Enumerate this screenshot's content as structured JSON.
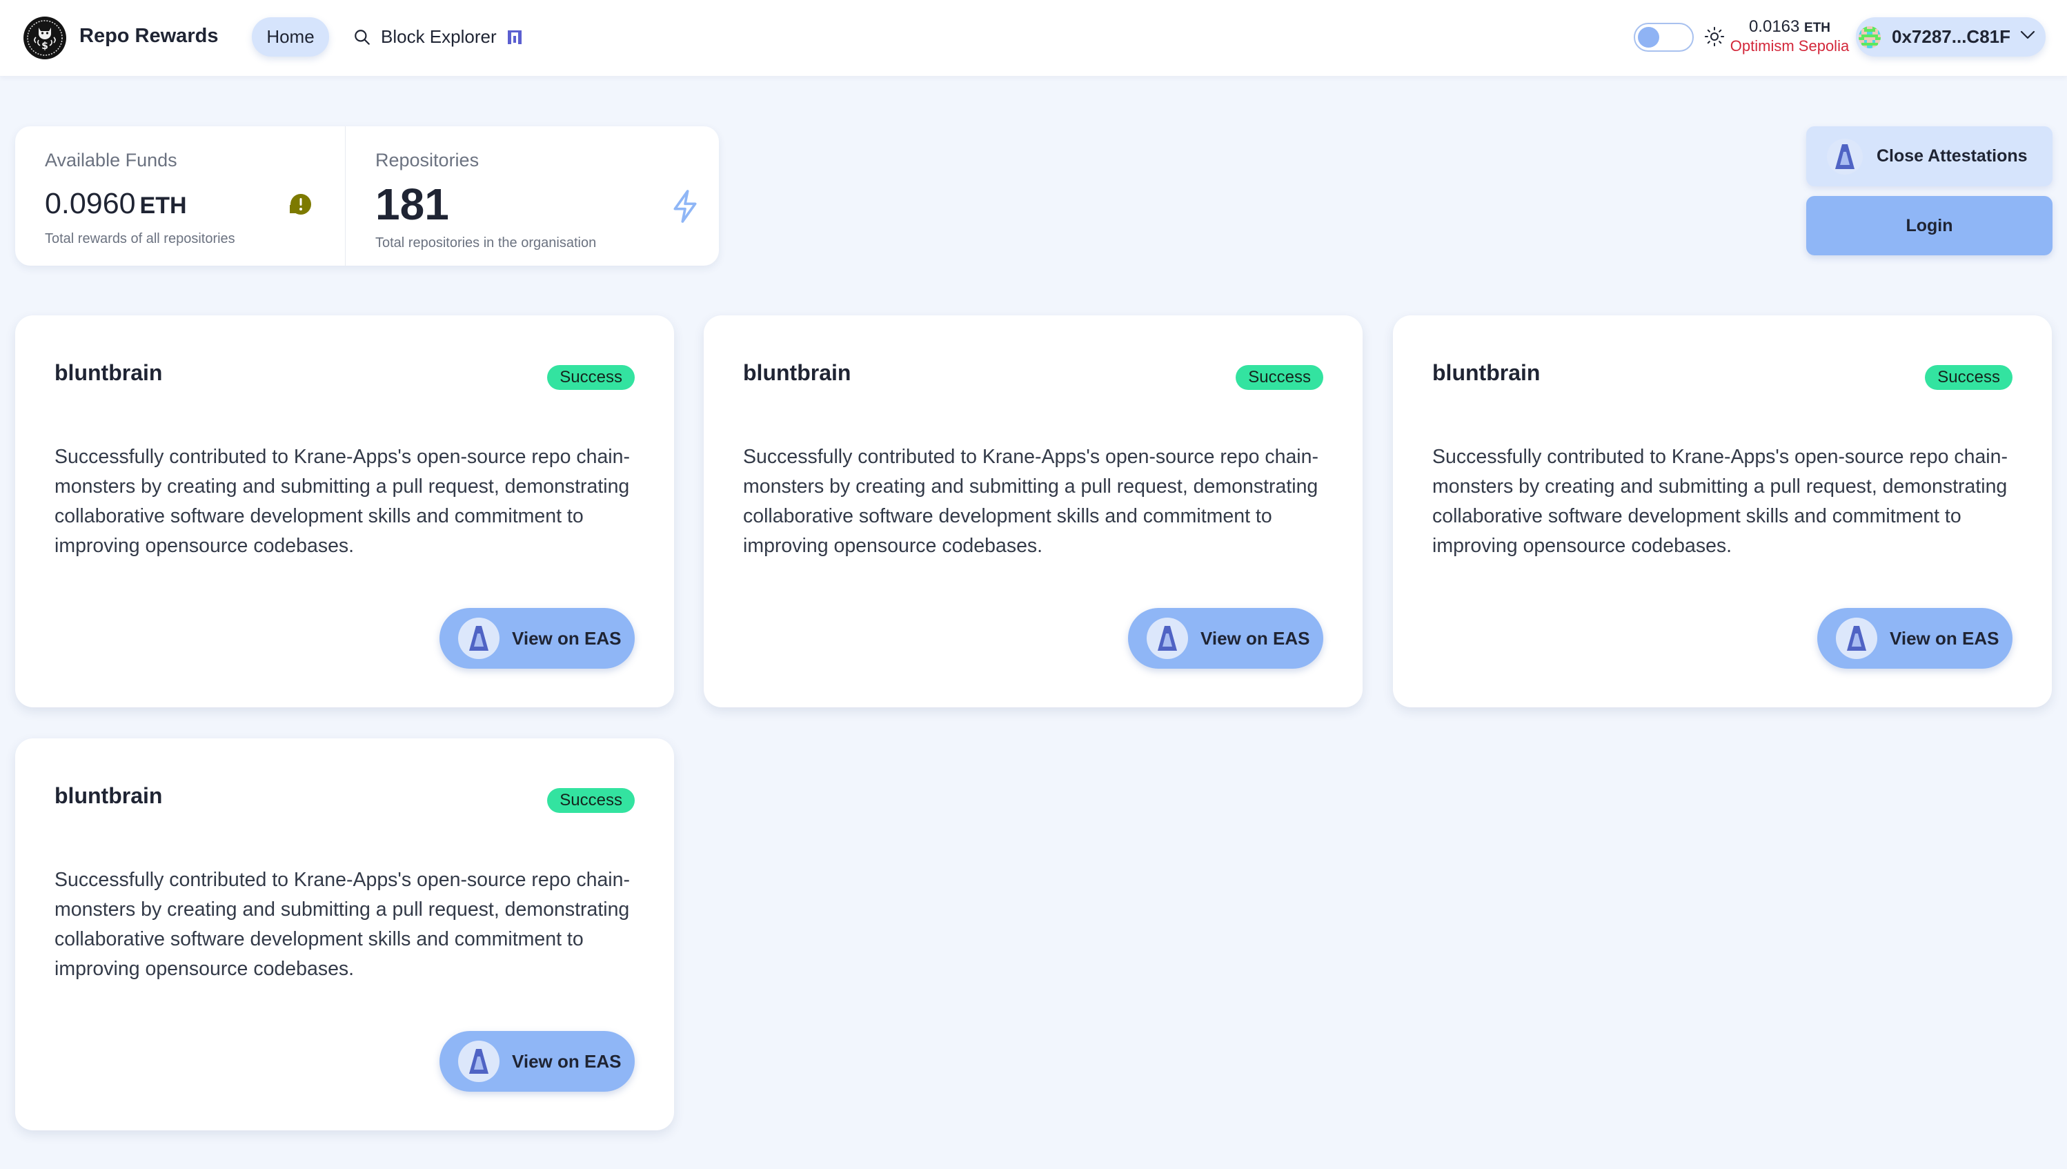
{
  "header": {
    "app_title": "Repo Rewards",
    "logo_icon": "octocat-coin-logo",
    "nav": [
      {
        "label": "Home",
        "active": true
      },
      {
        "label": "Block Explorer",
        "icon": "search-icon",
        "trailing_icon": "binoculars-icon"
      }
    ],
    "theme_toggle": {
      "state": "light"
    },
    "balance": {
      "amount": "0.0163",
      "unit": "ETH",
      "network": "Optimism Sepolia"
    },
    "wallet": {
      "address": "0x7287...C81F",
      "icon": "chevron-down-icon"
    }
  },
  "stats": [
    {
      "label": "Available Funds",
      "value": "0.0960",
      "unit": "ETH",
      "description": "Total rewards of all repositories",
      "icon": "alert-icon",
      "icon_color": "#7d7a00"
    },
    {
      "label": "Repositories",
      "value": "181",
      "unit": "",
      "description": "Total repositories in the organisation",
      "icon": "lightning-icon",
      "icon_color": "#8fb6f6"
    }
  ],
  "actions": {
    "close_attestations": "Close Attestations",
    "login": "Login"
  },
  "cards": [
    {
      "name": "bluntbrain",
      "status": "Success",
      "description": "Successfully contributed to Krane-Apps's open-source repo chain-monsters by creating and submitting a pull request, demonstrating collaborative software development skills and commitment to improving opensource codebases.",
      "button": "View on EAS"
    },
    {
      "name": "bluntbrain",
      "status": "Success",
      "description": "Successfully contributed to Krane-Apps's open-source repo chain-monsters by creating and submitting a pull request, demonstrating collaborative software development skills and commitment to improving opensource codebases.",
      "button": "View on EAS"
    },
    {
      "name": "bluntbrain",
      "status": "Success",
      "description": "Successfully contributed to Krane-Apps's open-source repo chain-monsters by creating and submitting a pull request, demonstrating collaborative software development skills and commitment to improving opensource codebases.",
      "button": "View on EAS"
    },
    {
      "name": "bluntbrain",
      "status": "Success",
      "description": "Successfully contributed to Krane-Apps's open-source repo chain-monsters by creating and submitting a pull request, demonstrating collaborative software development skills and commitment to improving opensource codebases.",
      "button": "View on EAS"
    }
  ],
  "colors": {
    "background": "#f2f6fd",
    "accent_light": "#d6e4fc",
    "accent": "#8fb6f6",
    "success": "#33e3a0",
    "network_red": "#d3283b",
    "eas_blue": "#4f63c4"
  }
}
